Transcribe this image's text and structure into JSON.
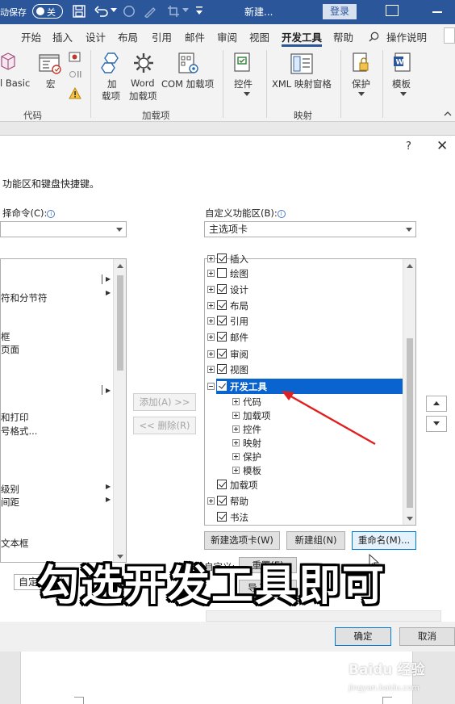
{
  "titlebar": {
    "autosave_label": "动保存",
    "autosave_state": "关",
    "doc_name": "新建...",
    "login_label": "登录"
  },
  "tabs": [
    {
      "label": "开始"
    },
    {
      "label": "插入"
    },
    {
      "label": "设计"
    },
    {
      "label": "布局"
    },
    {
      "label": "引用"
    },
    {
      "label": "邮件"
    },
    {
      "label": "审阅"
    },
    {
      "label": "视图"
    },
    {
      "label": "开发工具",
      "active": true
    },
    {
      "label": "帮助"
    },
    {
      "label": "操作说明"
    }
  ],
  "ribbon": {
    "groups": {
      "code": "代码",
      "addins": "加载项",
      "mapping": "映射"
    },
    "buttons": {
      "visual_basic": "l Basic",
      "macros": "宏",
      "addins_line1": "加",
      "addins_line2": "载项",
      "word_line1": "Word",
      "word_line2": "加载项",
      "com_addins": "COM 加载项",
      "controls": "控件",
      "xml_mapping": "XML 映射窗格",
      "protect": "保护",
      "templates": "模板"
    }
  },
  "dialog": {
    "help": "?",
    "close": "✕",
    "description": "功能区和键盘快捷键。",
    "left_label": "择命令(C):",
    "right_label": "自定义功能区(B):",
    "right_combo_value": "主选项卡",
    "left_list": [
      {
        "text": "符和分节符"
      },
      {
        "text": "框"
      },
      {
        "text": "页面"
      },
      {
        "text": "和打印"
      },
      {
        "text": "号格式..."
      },
      {
        "text": "级别"
      },
      {
        "text": "间距"
      },
      {
        "text": "文本框"
      }
    ],
    "add_button": "添加(A) >>",
    "remove_button": "<< 删除(R)",
    "tree": [
      {
        "label": "插入"
      },
      {
        "label": "绘图"
      },
      {
        "label": "设计"
      },
      {
        "label": "布局"
      },
      {
        "label": "引用"
      },
      {
        "label": "邮件"
      },
      {
        "label": "审阅"
      },
      {
        "label": "视图"
      },
      {
        "label": "开发工具"
      },
      {
        "label": "代码"
      },
      {
        "label": "加载项"
      },
      {
        "label": "控件"
      },
      {
        "label": "映射"
      },
      {
        "label": "保护"
      },
      {
        "label": "模板"
      },
      {
        "label": "加载项"
      },
      {
        "label": "帮助"
      },
      {
        "label": "书法"
      }
    ],
    "new_tab_button": "新建选项卡(W)",
    "new_group_button": "新建组(N)",
    "rename_button": "重命名(M)...",
    "left_bottom_combo": "自定",
    "custom_label": "自定义:",
    "reset_button": "重置(E)",
    "import_export_button": "导入/导出",
    "ok_button": "确定",
    "cancel_button": "取消"
  },
  "caption": "勾选开发工具即可",
  "watermark": {
    "brand": "Baidu 经验",
    "url": "jingyan.baidu.com"
  },
  "colors": {
    "accent_blue": "#2b579a",
    "selection_blue": "#0a64cf",
    "annotation_red": "#e02020"
  }
}
